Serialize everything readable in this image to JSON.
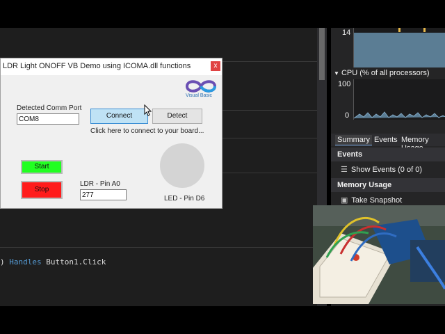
{
  "colors": {
    "editor_bg": "#1e1e1e",
    "keyword": "#569cd6",
    "start_green": "#22ff22",
    "stop_red": "#ff1c1c",
    "connect_blue": "#bfe2f5",
    "graph_fill": "#5b7d94"
  },
  "editor": {
    "code_prefix": ") ",
    "code_keyword": "Handles",
    "code_rest": " Button1.Click"
  },
  "diagnostics": {
    "memory_graph_value": "14",
    "cpu_header": "CPU (% of all processors)",
    "cpu_max": "100",
    "cpu_min": "0",
    "tabs": [
      "Summary",
      "Events",
      "Memory Usage"
    ],
    "events_section": "Events",
    "show_events": "Show Events (0 of 0)",
    "memory_section": "Memory Usage",
    "take_snapshot": "Take Snapshot"
  },
  "dialog": {
    "title": "LDR Light ONOFF VB Demo using ICOMA.dll functions",
    "close_glyph": "x",
    "logo_text": "Visual Basic",
    "comm_port_label": "Detected Comm Port",
    "comm_port_value": "COM8",
    "connect_label": "Connect",
    "detect_label": "Detect",
    "hint_text": "Click here to connect to your board...",
    "start_label": "Start",
    "stop_label": "Stop",
    "ldr_label": "LDR - Pin A0",
    "ldr_value": "277",
    "led_label": "LED - Pin D6"
  }
}
